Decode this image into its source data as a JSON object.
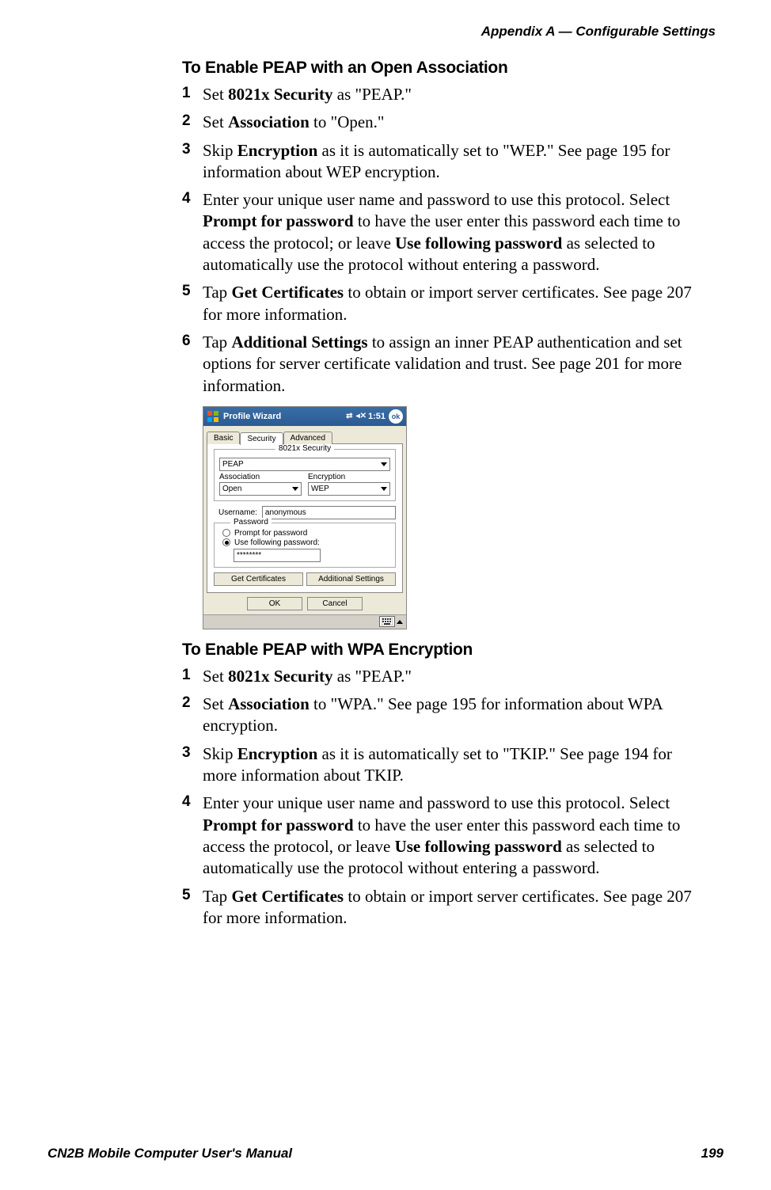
{
  "header": "Appendix A —  Configurable Settings",
  "section1": {
    "title": "To Enable PEAP with an Open Association",
    "steps": [
      {
        "n": "1",
        "parts": [
          "Set ",
          "8021x Security",
          " as \"PEAP.\""
        ]
      },
      {
        "n": "2",
        "parts": [
          "Set ",
          "Association",
          " to \"Open.\""
        ]
      },
      {
        "n": "3",
        "parts": [
          "Skip ",
          "Encryption",
          " as it is automatically set to \"WEP.\" See page 195 for information about WEP encryption."
        ]
      },
      {
        "n": "4",
        "parts": [
          "Enter your unique user name and password to use this protocol. Select ",
          "Prompt for password",
          " to have the user enter this password each time to access the protocol; or leave ",
          "Use following password",
          " as selected to automatically use the protocol without entering a password."
        ]
      },
      {
        "n": "5",
        "parts": [
          "Tap ",
          "Get Certificates",
          " to obtain or import server certificates. See page 207 for more information."
        ]
      },
      {
        "n": "6",
        "parts": [
          "Tap ",
          "Additional Settings",
          " to assign an inner PEAP authentication and set options for server certificate validation and trust. See page 201 for more information."
        ]
      }
    ]
  },
  "screenshot": {
    "title": "Profile Wizard",
    "time": "1:51",
    "ok_round": "ok",
    "tabs": {
      "basic": "Basic",
      "security": "Security",
      "advanced": "Advanced"
    },
    "security_group": "8021x Security",
    "security_value": "PEAP",
    "assoc_label": "Association",
    "assoc_value": "Open",
    "enc_label": "Encryption",
    "enc_value": "WEP",
    "username_label": "Username:",
    "username_value": "anonymous",
    "password_group": "Password",
    "radio_prompt": "Prompt for password",
    "radio_use": "Use following password:",
    "password_value": "********",
    "btn_getcert": "Get Certificates",
    "btn_addl": "Additional Settings",
    "btn_ok": "OK",
    "btn_cancel": "Cancel"
  },
  "section2": {
    "title": "To Enable PEAP with WPA Encryption",
    "steps": [
      {
        "n": "1",
        "parts": [
          "Set ",
          "8021x Security",
          " as \"PEAP.\""
        ]
      },
      {
        "n": "2",
        "parts": [
          "Set ",
          "Association",
          " to \"WPA.\" See page 195 for information about WPA encryption."
        ]
      },
      {
        "n": "3",
        "parts": [
          "Skip ",
          "Encryption",
          " as it is automatically set to \"TKIP.\" See page 194 for more information about TKIP."
        ]
      },
      {
        "n": "4",
        "parts": [
          "Enter your unique user name and password to use this protocol. Select ",
          "Prompt for password",
          " to have the user enter this password each time to access the protocol, or leave ",
          "Use following password",
          " as selected to automatically use the protocol without entering a password."
        ]
      },
      {
        "n": "5",
        "parts": [
          "Tap ",
          "Get Certificates",
          " to obtain or import server certificates. See page 207 for more information."
        ]
      }
    ]
  },
  "footer": {
    "left": "CN2B Mobile Computer User's Manual",
    "right": "199"
  }
}
